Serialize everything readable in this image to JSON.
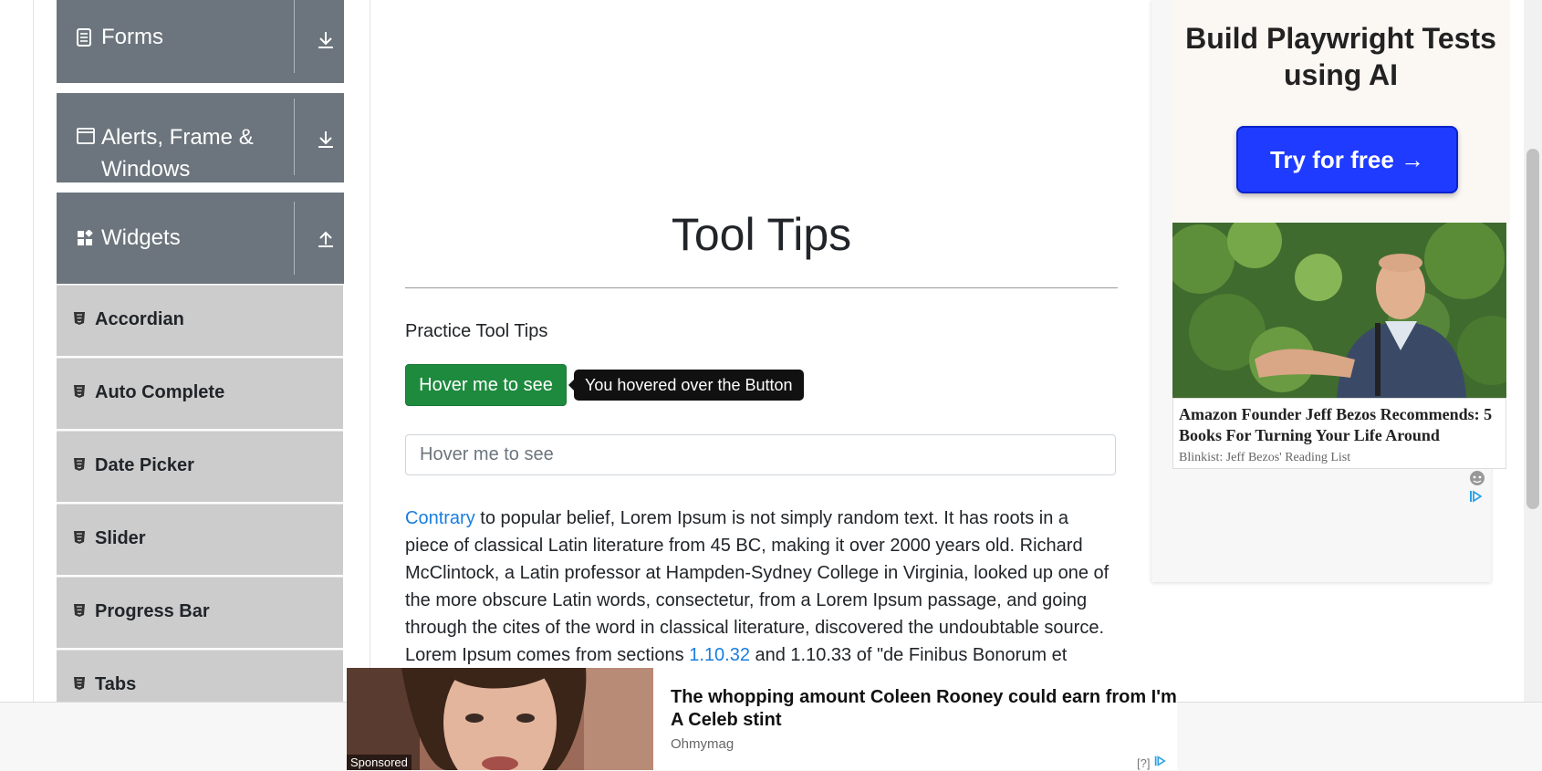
{
  "sidebar": {
    "groups": [
      {
        "label": "Forms",
        "icon": "document-icon",
        "arrow": "download-arrow"
      },
      {
        "label_line1": "Alerts, Frame &",
        "label_line2": "Windows",
        "icon": "window-icon",
        "arrow": "download-arrow"
      },
      {
        "label": "Widgets",
        "icon": "widgets-icon",
        "arrow": "upload-arrow"
      }
    ],
    "items": [
      {
        "label": "Accordian"
      },
      {
        "label": "Auto Complete"
      },
      {
        "label": "Date Picker"
      },
      {
        "label": "Slider"
      },
      {
        "label": "Progress Bar"
      },
      {
        "label": "Tabs"
      }
    ]
  },
  "main": {
    "title": "Tool Tips",
    "subtitle": "Practice Tool Tips",
    "button_label": "Hover me to see",
    "tooltip_text": "You hovered over the Button",
    "input_placeholder": "Hover me to see",
    "paragraph": {
      "link1": "Contrary",
      "text1": " to popular belief, Lorem Ipsum is not simply random text. It has roots in a piece of classical Latin literature from 45 BC, making it over 2000 years old. Richard McClintock, a Latin professor at Hampden-Sydney College in Virginia, looked up one of the more obscure Latin words, consectetur, from a Lorem Ipsum passage, and going through the cites of the word in classical literature, discovered the undoubtable source. Lorem Ipsum comes from sections ",
      "link2": "1.10.32",
      "text2": " and 1.10.33 of \"de Finibus Bonorum et"
    }
  },
  "ad_right": {
    "headline": "Build Playwright Tests using AI",
    "cta": "Try for free →",
    "story_title": "Amazon Founder Jeff Bezos Recommends: 5 Books For Turning Your Life Around",
    "story_source": "Blinkist: Jeff Bezos' Reading List"
  },
  "ad_bottom": {
    "sponsored": "Sponsored",
    "title": "The whopping amount Coleen Rooney could earn from I'm A Celeb stint",
    "source": "Ohmymag",
    "info": "[?]"
  },
  "colors": {
    "sidebar_header": "#6c757d",
    "sidebar_item": "#cccccc",
    "button_green": "#1e8a3e",
    "link_blue": "#1a7ee0",
    "ad_cta_blue": "#1f3bff"
  }
}
